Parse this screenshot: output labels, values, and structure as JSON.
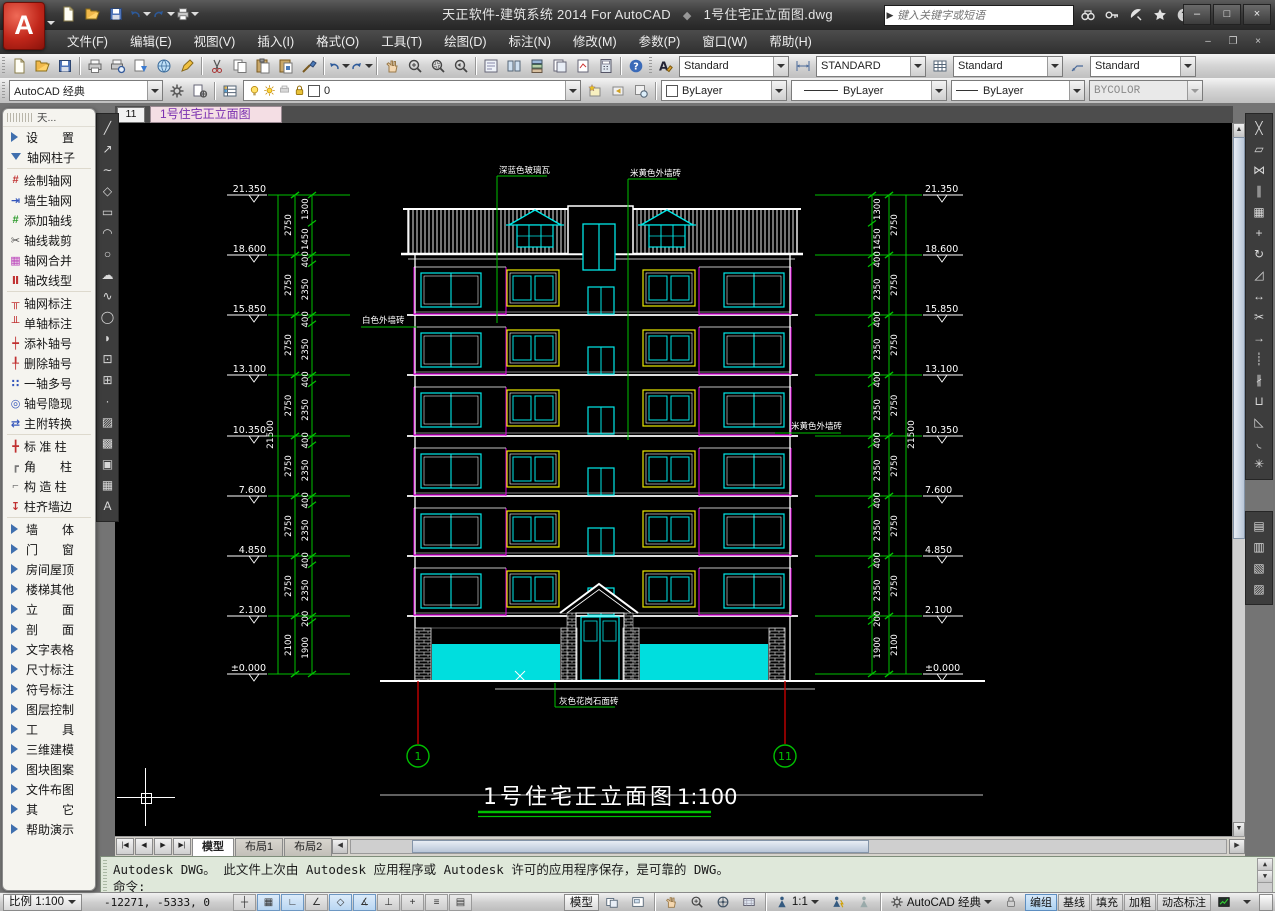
{
  "titlebar": {
    "app_title": "天正软件-建筑系统 2014  For AutoCAD",
    "doc_title": "1号住宅正立面图.dwg",
    "search_placeholder": "键入关键字或短语",
    "window_buttons": [
      "–",
      "□",
      "×"
    ]
  },
  "menus": [
    "文件(F)",
    "编辑(E)",
    "视图(V)",
    "插入(I)",
    "格式(O)",
    "工具(T)",
    "绘图(D)",
    "标注(N)",
    "修改(M)",
    "参数(P)",
    "窗口(W)",
    "帮助(H)"
  ],
  "doc_window_buttons": [
    "–",
    "❐",
    "×"
  ],
  "toolbar1": {
    "groups": [
      [
        "file-new",
        "folder-open",
        "save"
      ],
      [
        "print",
        "print-preview",
        "publish",
        "etransmit",
        "markup"
      ],
      [
        "cut",
        "copy",
        "paste",
        "paste-as-block",
        "match-properties"
      ],
      [
        "undo",
        "redo"
      ],
      [
        "pan",
        "zoom-realtime",
        "zoom-window",
        "zoom-previous"
      ],
      [
        "properties",
        "designcenter",
        "tool-palettes",
        "sheetset-manager",
        "markup-set-manager",
        "quickcalc"
      ],
      [
        "help"
      ]
    ],
    "text_style": "Standard",
    "dim_style": "STANDARD",
    "table_style": "Standard",
    "mleader_style": "Standard"
  },
  "toolbar2": {
    "workspace": "AutoCAD 经典",
    "layer_name": "0",
    "color": "ByLayer",
    "linetype": "ByLayer",
    "lineweight": "ByLayer",
    "plot_style": "BYCOLOR"
  },
  "palette": {
    "title": "天...",
    "items": [
      {
        "kind": "group",
        "label": "设　　置",
        "collapsed": true,
        "name": "palette-group-settings"
      },
      {
        "kind": "group",
        "label": "轴网柱子",
        "collapsed": false,
        "name": "palette-group-axis-column"
      },
      {
        "kind": "item",
        "label": "绘制轴网",
        "glyph": "#",
        "color": "#c03030",
        "name": "draw-axis-grid",
        "sep": true
      },
      {
        "kind": "item",
        "label": "墙生轴网",
        "glyph": "⇥",
        "color": "#3355bb",
        "name": "wall-generate-axis"
      },
      {
        "kind": "item",
        "label": "添加轴线",
        "glyph": "#",
        "color": "#2a9a2a",
        "name": "add-axis-line"
      },
      {
        "kind": "item",
        "label": "轴线裁剪",
        "glyph": "✂",
        "color": "#444444",
        "name": "clip-axis-line"
      },
      {
        "kind": "item",
        "label": "轴网合并",
        "glyph": "▦",
        "color": "#bb44bb",
        "name": "merge-axis-grid"
      },
      {
        "kind": "item",
        "label": "轴改线型",
        "glyph": "Ⅱ",
        "color": "#c03030",
        "name": "axis-linetype"
      },
      {
        "kind": "item",
        "label": "轴网标注",
        "glyph": "╥",
        "color": "#c03030",
        "name": "axis-grid-dimension",
        "sep": true
      },
      {
        "kind": "item",
        "label": "单轴标注",
        "glyph": "╨",
        "color": "#c03030",
        "name": "single-axis-dimension"
      },
      {
        "kind": "item",
        "label": "添补轴号",
        "glyph": "┿",
        "color": "#c03030",
        "name": "add-axis-number"
      },
      {
        "kind": "item",
        "label": "删除轴号",
        "glyph": "╀",
        "color": "#c03030",
        "name": "delete-axis-number"
      },
      {
        "kind": "item",
        "label": "一轴多号",
        "glyph": "∷",
        "color": "#3355bb",
        "name": "one-axis-multi-number"
      },
      {
        "kind": "item",
        "label": "轴号隐现",
        "glyph": "◎",
        "color": "#3355bb",
        "name": "axis-number-visibility"
      },
      {
        "kind": "item",
        "label": "主附转换",
        "glyph": "⇄",
        "color": "#3355bb",
        "name": "main-sub-convert"
      },
      {
        "kind": "item",
        "label": "标 准 柱",
        "glyph": "╋",
        "color": "#c03030",
        "name": "standard-column",
        "sep": true
      },
      {
        "kind": "item",
        "label": "角　　柱",
        "glyph": "┏",
        "color": "#777777",
        "name": "corner-column"
      },
      {
        "kind": "item",
        "label": "构 造 柱",
        "glyph": "⌐",
        "color": "#777777",
        "name": "structural-column"
      },
      {
        "kind": "item",
        "label": "柱齐墙边",
        "glyph": "↧",
        "color": "#c03030",
        "name": "column-align-wall"
      },
      {
        "kind": "group",
        "label": "墙　　体",
        "collapsed": true,
        "name": "palette-group-wall",
        "sep": true
      },
      {
        "kind": "group",
        "label": "门　　窗",
        "collapsed": true,
        "name": "palette-group-door-window"
      },
      {
        "kind": "group",
        "label": "房间屋顶",
        "collapsed": true,
        "name": "palette-group-room-roof"
      },
      {
        "kind": "group",
        "label": "楼梯其他",
        "collapsed": true,
        "name": "palette-group-stair-other"
      },
      {
        "kind": "group",
        "label": "立　　面",
        "collapsed": true,
        "name": "palette-group-elevation"
      },
      {
        "kind": "group",
        "label": "剖　　面",
        "collapsed": true,
        "name": "palette-group-section"
      },
      {
        "kind": "group",
        "label": "文字表格",
        "collapsed": true,
        "name": "palette-group-text-table"
      },
      {
        "kind": "group",
        "label": "尺寸标注",
        "collapsed": true,
        "name": "palette-group-dimension"
      },
      {
        "kind": "group",
        "label": "符号标注",
        "collapsed": true,
        "name": "palette-group-symbol"
      },
      {
        "kind": "group",
        "label": "图层控制",
        "collapsed": true,
        "name": "palette-group-layer"
      },
      {
        "kind": "group",
        "label": "工　　具",
        "collapsed": true,
        "name": "palette-group-tools"
      },
      {
        "kind": "group",
        "label": "三维建模",
        "collapsed": true,
        "name": "palette-group-3d-model"
      },
      {
        "kind": "group",
        "label": "图块图案",
        "collapsed": true,
        "name": "palette-group-block-pattern"
      },
      {
        "kind": "group",
        "label": "文件布图",
        "collapsed": true,
        "name": "palette-group-file-layout"
      },
      {
        "kind": "group",
        "label": "其　　它",
        "collapsed": true,
        "name": "palette-group-other"
      },
      {
        "kind": "group",
        "label": "帮助演示",
        "collapsed": true,
        "name": "palette-group-help-demo"
      }
    ]
  },
  "draw_toolbar": [
    {
      "name": "line",
      "g": "╱"
    },
    {
      "name": "construction-line",
      "g": "↗"
    },
    {
      "name": "polyline",
      "g": "∼"
    },
    {
      "name": "polygon",
      "g": "◇"
    },
    {
      "name": "rectangle",
      "g": "▭"
    },
    {
      "name": "arc",
      "g": "◠"
    },
    {
      "name": "circle",
      "g": "○"
    },
    {
      "name": "revcloud",
      "g": "☁"
    },
    {
      "name": "spline",
      "g": "∿"
    },
    {
      "name": "ellipse",
      "g": "◯"
    },
    {
      "name": "ellipse-arc",
      "g": "◗"
    },
    {
      "name": "insert-block",
      "g": "⊡"
    },
    {
      "name": "make-block",
      "g": "⊞"
    },
    {
      "name": "point",
      "g": "·"
    },
    {
      "name": "hatch",
      "g": "▨"
    },
    {
      "name": "gradient",
      "g": "▩"
    },
    {
      "name": "region",
      "g": "▣"
    },
    {
      "name": "table",
      "g": "▦"
    },
    {
      "name": "mtext",
      "g": "A"
    }
  ],
  "modify_toolbar": [
    {
      "name": "erase",
      "g": "╳"
    },
    {
      "name": "copy-object",
      "g": "▱"
    },
    {
      "name": "mirror",
      "g": "⋈"
    },
    {
      "name": "offset",
      "g": "∥"
    },
    {
      "name": "array",
      "g": "▦"
    },
    {
      "name": "move",
      "g": "+"
    },
    {
      "name": "rotate",
      "g": "↻"
    },
    {
      "name": "scale",
      "g": "◿"
    },
    {
      "name": "stretch",
      "g": "↔"
    },
    {
      "name": "trim",
      "g": "✂"
    },
    {
      "name": "extend",
      "g": "→"
    },
    {
      "name": "break-at-point",
      "g": "┊"
    },
    {
      "name": "break",
      "g": "∦"
    },
    {
      "name": "join",
      "g": "⊔"
    },
    {
      "name": "chamfer",
      "g": "◺"
    },
    {
      "name": "fillet",
      "g": "◟"
    },
    {
      "name": "explode",
      "g": "✳"
    }
  ],
  "modify_toolbar_extra": [
    {
      "name": "draw-order-front",
      "g": "▤"
    },
    {
      "name": "draw-order-back",
      "g": "▥"
    },
    {
      "name": "group",
      "g": "▧"
    },
    {
      "name": "ungroup",
      "g": "▨"
    }
  ],
  "doc_tabs": {
    "number": "11",
    "name": "1号住宅正立面图"
  },
  "layout_tabs": [
    {
      "label": "模型",
      "active": true
    },
    {
      "label": "布局1",
      "active": false
    },
    {
      "label": "布局2",
      "active": false
    }
  ],
  "command_line": {
    "history": "Autodesk DWG。  此文件上次由 Autodesk 应用程序或 Autodesk 许可的应用程序保存，是可靠的 DWG。",
    "prompt": "命令:"
  },
  "statusbar": {
    "scale": "比例 1:100",
    "coords": "-12271, -5333, 0",
    "snap_toggles": [
      {
        "name": "snap",
        "g": "┼",
        "on": false
      },
      {
        "name": "grid",
        "g": "▦",
        "on": true
      },
      {
        "name": "ortho",
        "g": "∟",
        "on": true
      },
      {
        "name": "polar",
        "g": "∠",
        "on": false
      },
      {
        "name": "osnap",
        "g": "◇",
        "on": true
      },
      {
        "name": "otrack",
        "g": "∡",
        "on": true
      },
      {
        "name": "ducs",
        "g": "⊥",
        "on": false
      },
      {
        "name": "dyn",
        "g": "+",
        "on": false
      },
      {
        "name": "lwt",
        "g": "≡",
        "on": false
      },
      {
        "name": "qp",
        "g": "▤",
        "on": false
      }
    ],
    "model_label": "模型",
    "annotation_scale": "1:1",
    "workspace": "AutoCAD 经典",
    "tarch_toggles": [
      {
        "label": "编组",
        "on": true
      },
      {
        "label": "基线",
        "on": false
      },
      {
        "label": "填充",
        "on": false
      },
      {
        "label": "加粗",
        "on": false
      },
      {
        "label": "动态标注",
        "on": false
      }
    ]
  },
  "drawing": {
    "title": "1号住宅正立面图",
    "title_scale": "1:100",
    "levels": [
      "21.350",
      "18.600",
      "15.850",
      "13.100",
      "10.350",
      "7.600",
      "4.850",
      "2.100",
      "±0.000"
    ],
    "overall_dim": "21500",
    "floor_dims": [
      "2750",
      "2750",
      "2750",
      "2750",
      "2750",
      "2750",
      "2750",
      "2100"
    ],
    "sub_dims": [
      [
        "1300",
        "1450"
      ],
      [
        "400",
        "2350"
      ],
      [
        "400",
        "2350"
      ],
      [
        "400",
        "2350"
      ],
      [
        "400",
        "2350"
      ],
      [
        "400",
        "2350"
      ],
      [
        "400",
        "2350"
      ],
      [
        "200",
        "1900"
      ]
    ],
    "axis_bubbles": [
      "1",
      "11"
    ],
    "annotations": {
      "roof": "深蓝色玻璃瓦",
      "wall_top": "米黄色外墙砖",
      "wall_left": "白色外墙砖",
      "wall_right": "米黄色外墙砖",
      "base": "灰色花岗石面砖"
    }
  }
}
